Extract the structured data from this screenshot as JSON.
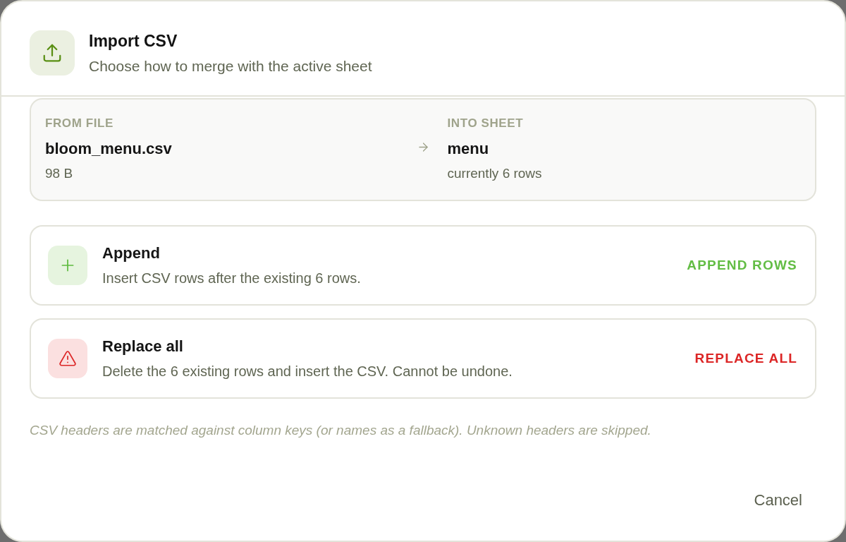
{
  "dialog": {
    "title": "Import CSV",
    "subtitle": "Choose how to merge with the active sheet"
  },
  "transfer": {
    "source": {
      "label": "FROM FILE",
      "name": "bloom_menu.csv",
      "detail": "98 B"
    },
    "target": {
      "label": "INTO SHEET",
      "name": "menu",
      "detail": "currently 6 rows"
    }
  },
  "options": [
    {
      "kind": "append",
      "title": "Append",
      "description": "Insert CSV rows after the existing 6 rows.",
      "action": "APPEND ROWS"
    },
    {
      "kind": "replace",
      "title": "Replace all",
      "description": "Delete the 6 existing rows and insert the CSV. Cannot be undone.",
      "action": "REPLACE ALL"
    }
  ],
  "note": "CSV headers are matched against column keys (or names as a fallback). Unknown headers are skipped.",
  "buttons": [
    {
      "label": "Cancel"
    }
  ]
}
